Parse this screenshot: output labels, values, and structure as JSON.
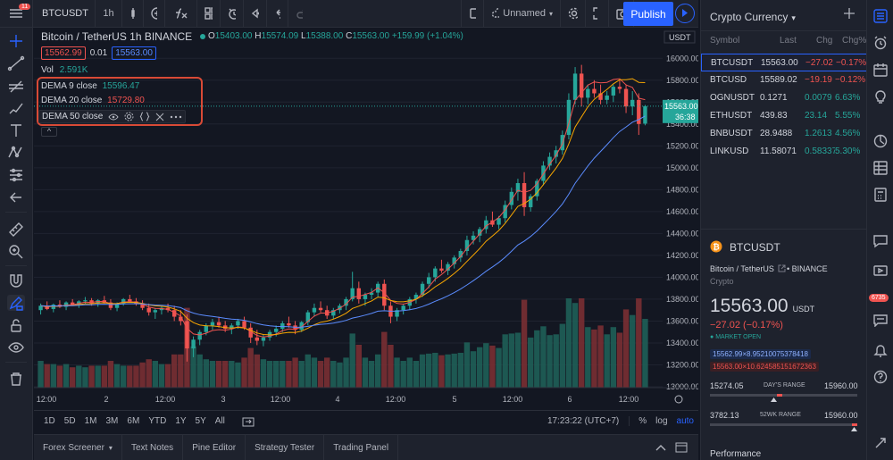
{
  "toolbar": {
    "symbol": "BTCUSDT",
    "interval": "1h",
    "layout_name": "Unnamed",
    "publish_label": "Publish",
    "notification_count": "11"
  },
  "legend": {
    "title": "Bitcoin / TetherUS  1h  BINANCE",
    "o_label": "O",
    "o": "15403.00",
    "h_label": "H",
    "h": "15574.09",
    "l_label": "L",
    "l": "15388.00",
    "c_label": "C",
    "c": "15563.00",
    "change": "+159.99 (+1.04%)",
    "bid": "15562.99",
    "spread": "0.01",
    "ask": "15563.00",
    "vol_label": "Vol",
    "vol": "2.591K",
    "dema9_label": "DEMA 9 close",
    "dema9_value": "15596.47",
    "dema20_label": "DEMA 20 close",
    "dema20_value": "15729.80",
    "dema50_label": "DEMA 50 close",
    "collapse": "^"
  },
  "price_axis": {
    "currency": "USDT",
    "ticks": [
      "16000.00",
      "15800.00",
      "15600.00",
      "15400.00",
      "15200.00",
      "15000.00",
      "14800.00",
      "14600.00",
      "14400.00",
      "14200.00",
      "14000.00",
      "13800.00",
      "13600.00",
      "13400.00",
      "13200.00",
      "13000.00"
    ],
    "last_price": "15563.00",
    "countdown": "36:38"
  },
  "time_axis": {
    "ticks": [
      "12:00",
      "2",
      "12:00",
      "3",
      "12:00",
      "4",
      "12:00",
      "5",
      "12:00",
      "6",
      "12:00"
    ]
  },
  "range_bar": {
    "ranges": [
      "1D",
      "5D",
      "1M",
      "3M",
      "6M",
      "YTD",
      "1Y",
      "5Y",
      "All"
    ],
    "clock": "17:23:22 (UTC+7)",
    "percent": "%",
    "log": "log",
    "auto": "auto"
  },
  "bottom_tabs": [
    "Forex Screener",
    "Text Notes",
    "Pine Editor",
    "Strategy Tester",
    "Trading Panel"
  ],
  "watchlist": {
    "title": "Crypto Currency",
    "headers": {
      "symbol": "Symbol",
      "last": "Last",
      "chg": "Chg",
      "chgp": "Chg%"
    },
    "rows": [
      {
        "symbol": "BTCUSDT",
        "last": "15563.00",
        "chg": "−27.02",
        "chgp": "−0.17%",
        "dir": "down"
      },
      {
        "symbol": "BTCUSD",
        "last": "15589.02",
        "chg": "−19.19",
        "chgp": "−0.12%",
        "dir": "down"
      },
      {
        "symbol": "OGNUSDT",
        "last": "0.1271",
        "chg": "0.0079",
        "chgp": "6.63%",
        "dir": "up"
      },
      {
        "symbol": "ETHUSDT",
        "last": "439.83",
        "chg": "23.14",
        "chgp": "5.55%",
        "dir": "up"
      },
      {
        "symbol": "BNBUSDT",
        "last": "28.9488",
        "chg": "1.2613",
        "chgp": "4.56%",
        "dir": "up"
      },
      {
        "symbol": "LINKUSD",
        "last": "11.58071",
        "chg": "0.583379",
        "chgp": "5.30%",
        "dir": "up"
      }
    ]
  },
  "detail": {
    "symbol": "BTCUSDT",
    "name": "Bitcoin / TetherUS",
    "exchange": "BINANCE",
    "type": "Crypto",
    "price_main": "1556",
    "price_tail": "3.00",
    "currency": "USDT",
    "change": "−27.02 (−0.17%)",
    "market_status": "MARKET OPEN",
    "bid_line": "15562.99×8.95210075378418",
    "ask_line": "15563.00×10.624585151672363",
    "day_low": "15274.05",
    "day_label": "DAY'S RANGE",
    "day_high": "15960.00",
    "wk_low": "3782.13",
    "wk_label": "52WK RANGE",
    "wk_high": "15960.00",
    "performance": "Performance"
  },
  "iconbar": {
    "alert_badge": "6735"
  },
  "colors": {
    "up": "#26a69a",
    "down": "#ef5350",
    "accent": "#2962ff",
    "dema9": "#ef5350",
    "dema20": "#f7a600",
    "dema50": "#5b8cff",
    "highlight": "#d94a36"
  },
  "chart_data": {
    "type": "candlestick",
    "note_source": "approximate hourly BTCUSDT candles read from chart",
    "y_range": [
      13000,
      16100
    ],
    "candles": [
      [
        13700,
        13760,
        13660,
        13740
      ],
      [
        13740,
        13780,
        13700,
        13710
      ],
      [
        13710,
        13760,
        13680,
        13750
      ],
      [
        13750,
        13790,
        13720,
        13730
      ],
      [
        13730,
        13780,
        13700,
        13770
      ],
      [
        13770,
        13800,
        13740,
        13750
      ],
      [
        13750,
        13790,
        13720,
        13780
      ],
      [
        13780,
        13820,
        13760,
        13790
      ],
      [
        13790,
        13810,
        13740,
        13760
      ],
      [
        13760,
        13800,
        13730,
        13790
      ],
      [
        13790,
        13830,
        13760,
        13770
      ],
      [
        13770,
        13800,
        13700,
        13720
      ],
      [
        13720,
        13770,
        13690,
        13760
      ],
      [
        13760,
        13810,
        13740,
        13800
      ],
      [
        13800,
        13840,
        13770,
        13780
      ],
      [
        13780,
        13810,
        13740,
        13760
      ],
      [
        13760,
        13790,
        13700,
        13720
      ],
      [
        13720,
        13760,
        13650,
        13680
      ],
      [
        13680,
        13720,
        13620,
        13700
      ],
      [
        13700,
        13740,
        13660,
        13720
      ],
      [
        13720,
        13760,
        13680,
        13700
      ],
      [
        13700,
        13740,
        13600,
        13640
      ],
      [
        13640,
        13700,
        13560,
        13600
      ],
      [
        13600,
        13660,
        13230,
        13350
      ],
      [
        13350,
        13460,
        13270,
        13430
      ],
      [
        13430,
        13520,
        13380,
        13500
      ],
      [
        13500,
        13580,
        13470,
        13560
      ],
      [
        13560,
        13620,
        13520,
        13590
      ],
      [
        13590,
        13640,
        13540,
        13560
      ],
      [
        13560,
        13600,
        13500,
        13530
      ],
      [
        13530,
        13580,
        13480,
        13560
      ],
      [
        13560,
        13620,
        13530,
        13600
      ],
      [
        13600,
        13640,
        13520,
        13540
      ],
      [
        13540,
        13580,
        13400,
        13450
      ],
      [
        13450,
        13520,
        13380,
        13420
      ],
      [
        13420,
        13480,
        13370,
        13450
      ],
      [
        13450,
        13520,
        13420,
        13500
      ],
      [
        13500,
        13560,
        13460,
        13530
      ],
      [
        13530,
        13600,
        13500,
        13580
      ],
      [
        13580,
        13640,
        13540,
        13560
      ],
      [
        13560,
        13600,
        13480,
        13520
      ],
      [
        13520,
        13600,
        13500,
        13590
      ],
      [
        13590,
        13700,
        13560,
        13680
      ],
      [
        13680,
        13760,
        13640,
        13720
      ],
      [
        13720,
        13780,
        13680,
        13700
      ],
      [
        13700,
        13740,
        13620,
        13650
      ],
      [
        13650,
        13720,
        13620,
        13700
      ],
      [
        13700,
        13760,
        13670,
        13740
      ],
      [
        13740,
        13820,
        13700,
        13800
      ],
      [
        13800,
        14050,
        13780,
        13900
      ],
      [
        13900,
        13960,
        13760,
        13800
      ],
      [
        13800,
        13860,
        13740,
        13840
      ],
      [
        13840,
        13900,
        13800,
        13860
      ],
      [
        13860,
        13960,
        13820,
        13940
      ],
      [
        13940,
        13980,
        13700,
        13740
      ],
      [
        13740,
        13780,
        13580,
        13640
      ],
      [
        13640,
        13720,
        13600,
        13700
      ],
      [
        13700,
        13760,
        13660,
        13740
      ],
      [
        13740,
        13820,
        13700,
        13800
      ],
      [
        13800,
        13860,
        13760,
        13840
      ],
      [
        13840,
        13960,
        13820,
        13940
      ],
      [
        13940,
        14040,
        13900,
        14000
      ],
      [
        14000,
        14100,
        13960,
        14080
      ],
      [
        14080,
        14160,
        14040,
        14060
      ],
      [
        14060,
        14140,
        14020,
        14120
      ],
      [
        14120,
        14200,
        14080,
        14180
      ],
      [
        14180,
        14260,
        14140,
        14240
      ],
      [
        14240,
        14380,
        14200,
        14340
      ],
      [
        14340,
        14420,
        14300,
        14380
      ],
      [
        14380,
        14460,
        14320,
        14440
      ],
      [
        14440,
        14560,
        14400,
        14520
      ],
      [
        14520,
        14600,
        14460,
        14480
      ],
      [
        14480,
        14560,
        14440,
        14540
      ],
      [
        14540,
        14700,
        14500,
        14660
      ],
      [
        14660,
        14820,
        14620,
        14780
      ],
      [
        14780,
        14900,
        14700,
        14860
      ],
      [
        14860,
        14960,
        14560,
        14640
      ],
      [
        14640,
        14760,
        14600,
        14740
      ],
      [
        14740,
        14900,
        14700,
        14880
      ],
      [
        14880,
        15060,
        14840,
        15020
      ],
      [
        15020,
        15140,
        14980,
        15100
      ],
      [
        15100,
        15200,
        15040,
        15160
      ],
      [
        15160,
        15340,
        15120,
        15300
      ],
      [
        15300,
        15680,
        15260,
        15620
      ],
      [
        15620,
        15920,
        15580,
        15860
      ],
      [
        15860,
        15940,
        15560,
        15640
      ],
      [
        15640,
        15760,
        15580,
        15720
      ],
      [
        15720,
        15800,
        15640,
        15680
      ],
      [
        15680,
        15760,
        15580,
        15620
      ],
      [
        15620,
        15700,
        15580,
        15660
      ],
      [
        15660,
        15760,
        15600,
        15740
      ],
      [
        15740,
        15800,
        15680,
        15720
      ],
      [
        15720,
        15760,
        15500,
        15560
      ],
      [
        15560,
        15700,
        15480,
        15620
      ],
      [
        15620,
        15680,
        15300,
        15400
      ],
      [
        15403,
        15574,
        15388,
        15563
      ]
    ],
    "volume_scale": "relative"
  }
}
